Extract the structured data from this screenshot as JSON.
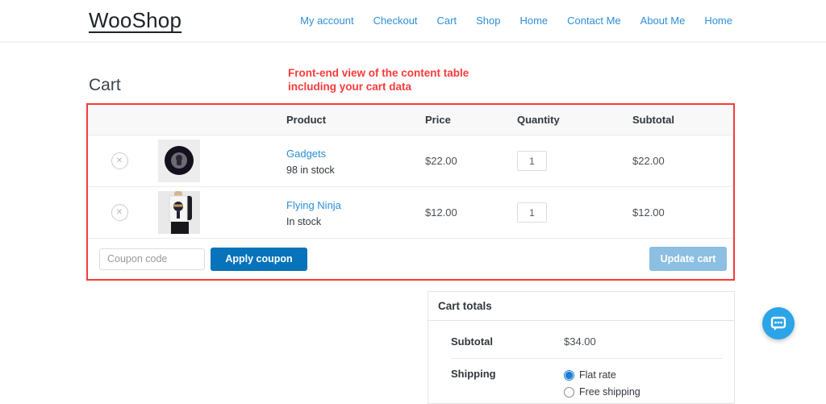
{
  "header": {
    "logo": "WooShop",
    "nav": [
      "My account",
      "Checkout",
      "Cart",
      "Shop",
      "Home",
      "Contact Me",
      "About Me",
      "Home"
    ]
  },
  "page": {
    "title": "Cart",
    "annotation_line1": "Front-end view of the content table",
    "annotation_line2": "including your cart data"
  },
  "cart_table": {
    "columns": {
      "product": "Product",
      "price": "Price",
      "quantity": "Quantity",
      "subtotal": "Subtotal"
    },
    "rows": [
      {
        "name": "Gadgets",
        "stock": "98 in stock",
        "price": "$22.00",
        "quantity": "1",
        "subtotal": "$22.00"
      },
      {
        "name": "Flying Ninja",
        "stock": "In stock",
        "price": "$12.00",
        "quantity": "1",
        "subtotal": "$12.00"
      }
    ],
    "remove_icon": "✕",
    "coupon_placeholder": "Coupon code",
    "apply_coupon_label": "Apply coupon",
    "update_cart_label": "Update cart"
  },
  "cart_totals": {
    "title": "Cart totals",
    "subtotal_label": "Subtotal",
    "subtotal_value": "$34.00",
    "shipping_label": "Shipping",
    "shipping_options": [
      {
        "label": "Flat rate",
        "selected": true
      },
      {
        "label": "Free shipping",
        "selected": false
      }
    ]
  },
  "colors": {
    "link_blue": "#2d8fd6",
    "button_blue": "#0673ba",
    "disabled_blue": "#8cbfe2",
    "annotation_red": "#fa3a3a",
    "chat_blue": "#2ba4e8"
  }
}
